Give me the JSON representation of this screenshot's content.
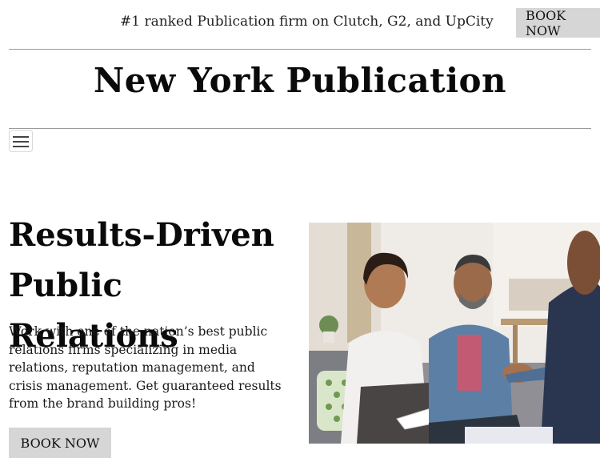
{
  "topbar": {
    "tagline": "#1 ranked Publication firm on Clutch, G2, and UpCity",
    "book_label": "BOOK NOW"
  },
  "brand": {
    "name": "New York Publication"
  },
  "nav": {
    "menu_icon": "hamburger-menu-icon"
  },
  "hero": {
    "title_line1": "Results-Driven",
    "title_line2": "Public Relations",
    "body": "Work with one of the nation’s best public relations firms specializing in media relations, reputation management, and crisis management. Get guaranteed results from the brand building pros!",
    "book_label": "BOOK NOW",
    "image": "people-meeting-photo"
  },
  "colors": {
    "button_bg": "#d6d6d6",
    "rule": "#9a9a9a"
  }
}
